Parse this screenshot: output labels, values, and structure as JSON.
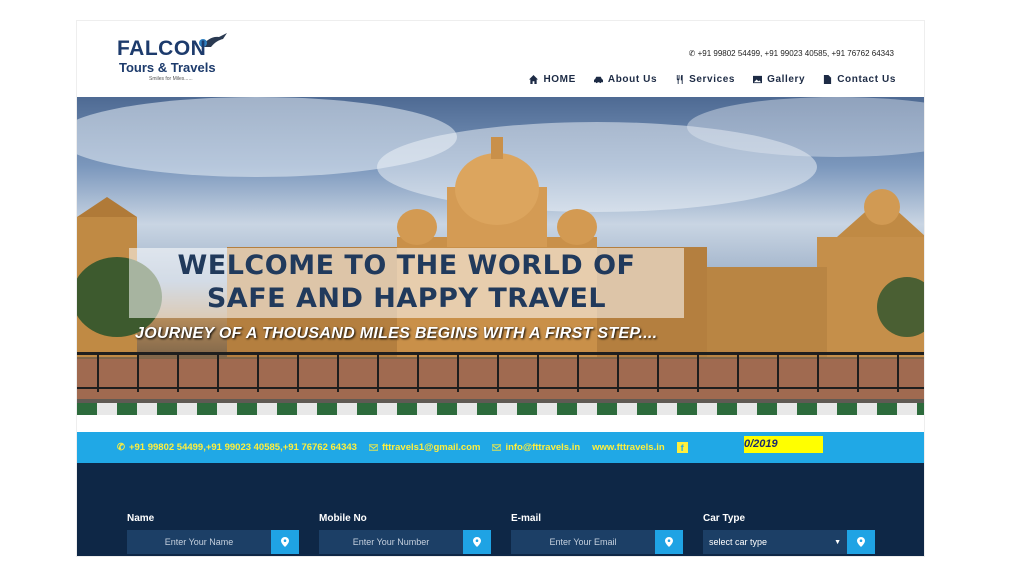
{
  "brand": {
    "name_line1": "FALCON",
    "name_line2": "Tours & Travels",
    "tagline": "Smiles for Miles......"
  },
  "header": {
    "phones": "+91 99802 54499, +91 99023 40585, +91 76762 64343"
  },
  "nav": [
    {
      "label": "HOME",
      "icon": "home-icon"
    },
    {
      "label": "About Us",
      "icon": "car-icon"
    },
    {
      "label": "Services",
      "icon": "cutlery-icon"
    },
    {
      "label": "Gallery",
      "icon": "image-icon"
    },
    {
      "label": "Contact Us",
      "icon": "file-icon"
    }
  ],
  "hero": {
    "headline_line1": "WELCOME TO THE WORLD OF",
    "headline_line2": "SAFE AND HAPPY TRAVEL",
    "subline": "JOURNEY OF A THOUSAND MILES BEGINS WITH A FIRST STEP...."
  },
  "contact_bar": {
    "phones": "+91 99802 54499,+91 99023 40585,+91 76762 64343",
    "email1": "fttravels1@gmail.com",
    "email2": "info@fttravels.in",
    "website": "www.fttravels.in",
    "facebook_glyph": "f",
    "marquee": "0/2019"
  },
  "form": {
    "name_label": "Name",
    "name_placeholder": "Enter Your Name",
    "mobile_label": "Mobile No",
    "mobile_placeholder": "Enter Your Number",
    "email_label": "E-mail",
    "email_placeholder": "Enter Your Email",
    "car_label": "Car Type",
    "car_selected": "select car type"
  },
  "colors": {
    "navy": "#1d3b6c",
    "contact_bar": "#20a8e6",
    "contact_text": "#ffef3c",
    "form_bg": "#0e2746",
    "pin_button": "#1fa3e4"
  }
}
